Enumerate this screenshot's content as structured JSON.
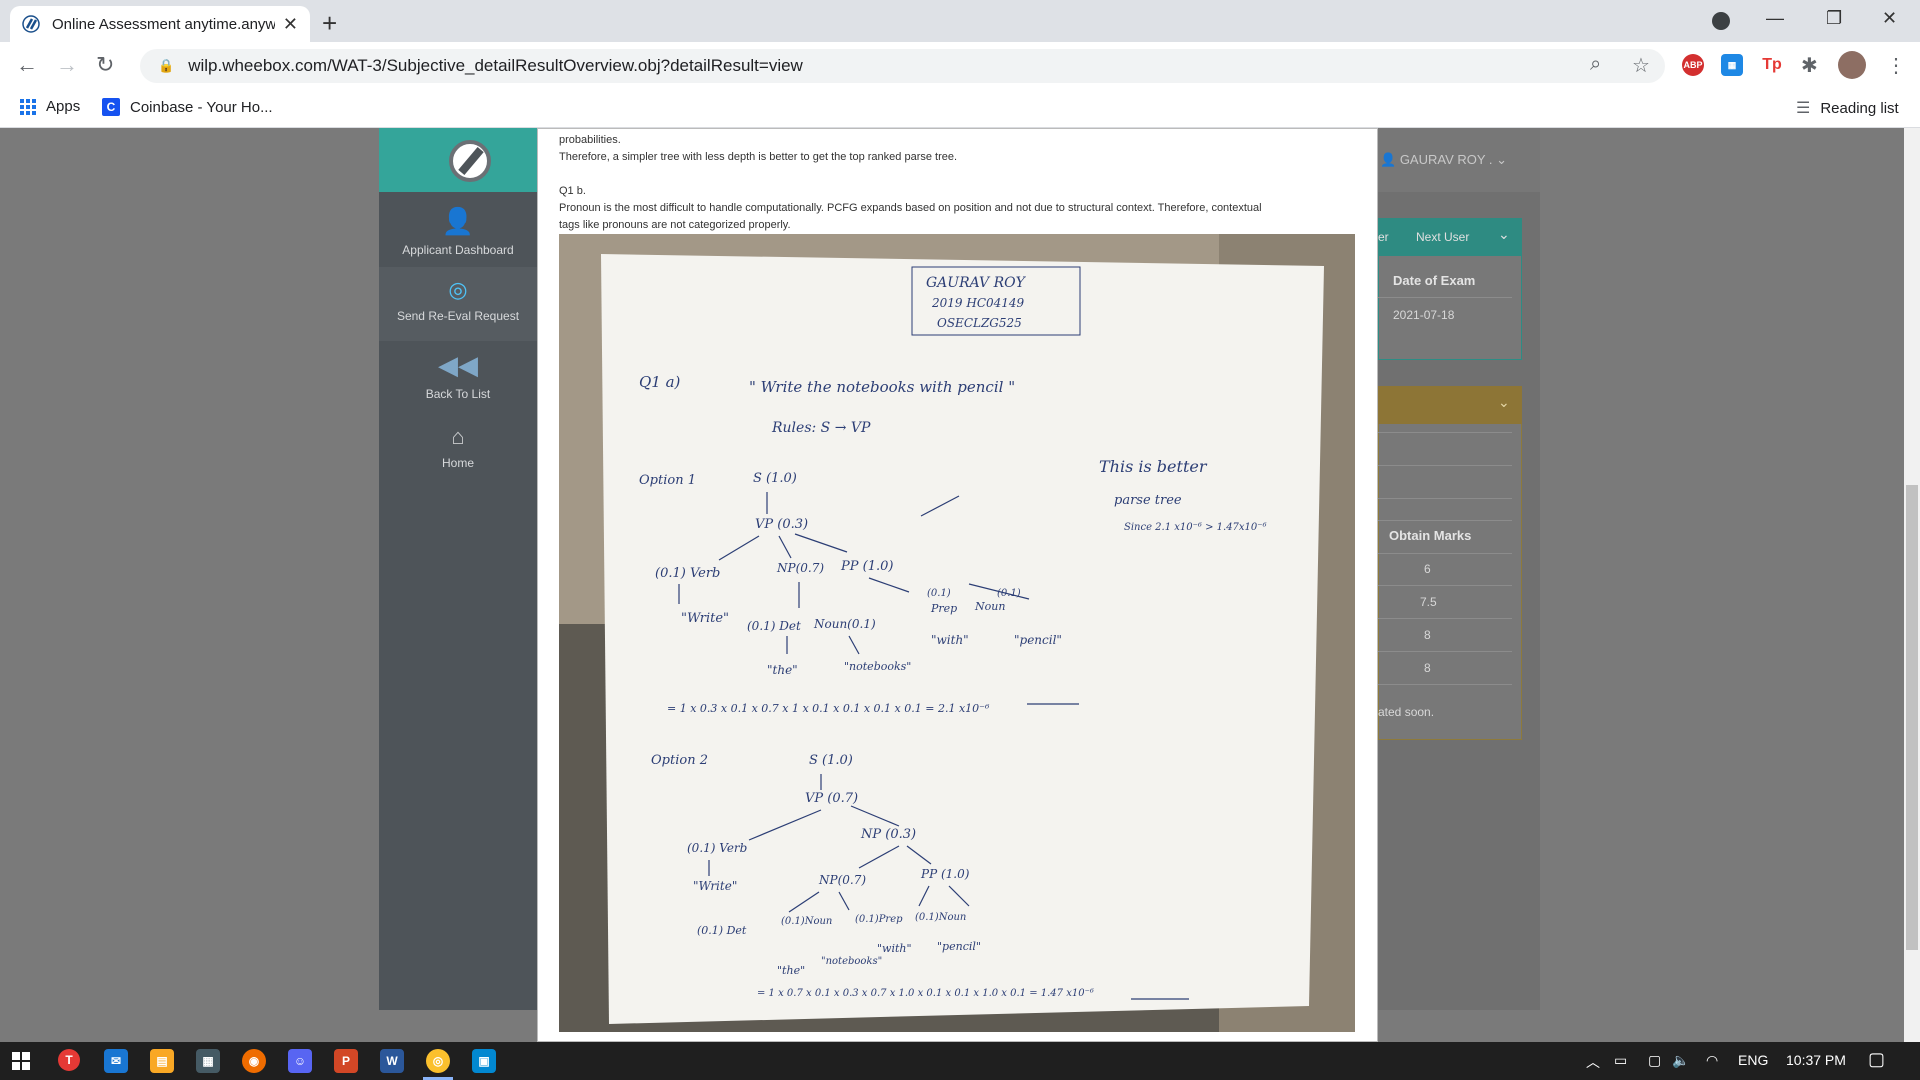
{
  "browser": {
    "tab_title": "Online Assessment anytime.anyw",
    "url": "wilp.wheebox.com/WAT-3/Subjective_detailResultOverview.obj?detailResult=view",
    "bookmarks": [
      {
        "label": "Apps"
      },
      {
        "label": "Coinbase - Your Ho..."
      }
    ],
    "reading_list": "Reading list",
    "extensions": [
      "ABP",
      "Tp"
    ]
  },
  "sidebar": {
    "items": [
      {
        "label": "Applicant Dashboard",
        "icon": "user-icon"
      },
      {
        "label": "Send Re-Eval Request",
        "icon": "target-icon"
      },
      {
        "label": "Back To List",
        "icon": "rewind-icon"
      },
      {
        "label": "Home",
        "icon": "home-icon"
      }
    ]
  },
  "right_panel": {
    "user_name": "GAURAV ROY .",
    "card1": {
      "prev_fragment": "er",
      "next_user": "Next User",
      "date_label": "Date of Exam",
      "date_value": "2021-07-18"
    },
    "card2": {
      "header": "Obtain Marks",
      "marks": [
        "6",
        "7.5",
        "8",
        "8"
      ],
      "footer": "ated soon."
    }
  },
  "modal": {
    "line1": "probabilities.",
    "line2": "Therefore, a simpler tree with less depth is better to get the top ranked parse tree.",
    "q_label": "Q1 b.",
    "answer_line1": "Pronoun is the most difficult to handle computationally. PCFG expands based on position and not due to structural context. Therefore, contextual",
    "answer_line2": "tags like pronouns are not categorized properly.",
    "photo": {
      "name_box": [
        "GAURAV   ROY",
        "2019 HC04149",
        "OSECLZG525"
      ],
      "q_heading": "Q1  a)",
      "sentence": "\" Write the notebooks with pencil \"",
      "rules": "Rules:     S → VP",
      "option1": "Option 1",
      "option2": "Option 2",
      "better_note": [
        "This is better",
        "parse tree",
        "Since 2.1 x10⁻⁶ > 1.47x10⁻⁶"
      ],
      "calc1": "= 1 x 0.3 x 0.1 x 0.7 x 1 x 0.1 x 0.1 x 0.1 x 0.1  =  2.1 x10⁻⁶",
      "calc2": "= 1 x 0.7 x 0.1 x 0.3 x 0.7 x 1.0 x 0.1 x 0.1 x 1.0 x 0.1 = 1.47 x10⁻⁶",
      "tree1": {
        "S": "S  (1.0)",
        "VP": "VP (0.3)",
        "Verb": "(0.1) Verb",
        "NP": "NP(0.7)",
        "PP": "PP (1.0)",
        "write": "\"Write\"",
        "Det": "(0.1) Det",
        "Noun": "Noun(0.1)",
        "Prep": "Prep",
        "Noun2": "Noun",
        "prep_p": "(0.1)",
        "noun2_p": "(0.1)",
        "the": "\"the\"",
        "notebooks": "\"notebooks\"",
        "with": "\"with\"",
        "pencil": "\"pencil\""
      },
      "tree2": {
        "S": "S  (1.0)",
        "VP": "VP (0.7)",
        "Verb": "(0.1) Verb",
        "NP": "NP (0.3)",
        "NP2": "NP(0.7)",
        "PP": "PP (1.0)",
        "write": "\"Write\"",
        "Det": "(0.1)  Det",
        "Noun": "(0.1)Noun",
        "Prep": "(0.1)Prep",
        "Noun2": "(0.1)Noun",
        "the": "\"the\"",
        "notebooks": "\"notebooks\"",
        "with": "\"with\"",
        "pencil": "\"pencil\""
      }
    }
  },
  "taskbar": {
    "lang": "ENG",
    "time": "10:37 PM"
  },
  "colors": {
    "sidebar": "#4e5459",
    "teal": "#34a59a",
    "gold": "#8d7536"
  }
}
